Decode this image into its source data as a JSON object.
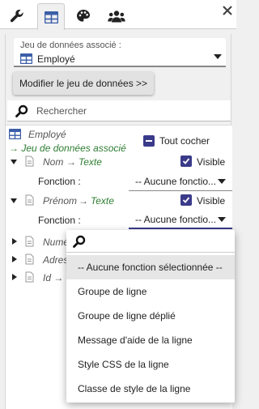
{
  "tabs": [
    {
      "icon": "wrench-icon"
    },
    {
      "icon": "table-icon",
      "active": true
    },
    {
      "icon": "palette-icon"
    },
    {
      "icon": "users-icon"
    }
  ],
  "dataset": {
    "label": "Jeu de données associé :",
    "value": "Employé"
  },
  "modify_button": "Modifier le jeu de données >>",
  "search": {
    "placeholder": "Rechercher"
  },
  "tree": {
    "root_label": "Employé",
    "associated_label": "→ Jeu de données associé",
    "check_all_label": "Tout cocher",
    "fields": [
      {
        "name": "Nom",
        "arrow": "→",
        "type": "Texte",
        "visible_label": "Visible",
        "function_label": "Fonction :",
        "function_value": "-- Aucune fonctio..."
      },
      {
        "name": "Prénom",
        "arrow": "→",
        "type": "Texte",
        "visible_label": "Visible",
        "function_label": "Fonction :",
        "function_value": "-- Aucune fonctio..."
      },
      {
        "name": "Numé"
      },
      {
        "name": "Adres"
      },
      {
        "name": "Id →"
      }
    ]
  },
  "dropdown": {
    "options": [
      "-- Aucune fonction sélectionnée --",
      "Groupe de ligne",
      "Groupe de ligne déplié",
      "Message d'aide de la ligne",
      "Style CSS de la ligne",
      "Classe de style de la ligne"
    ]
  }
}
